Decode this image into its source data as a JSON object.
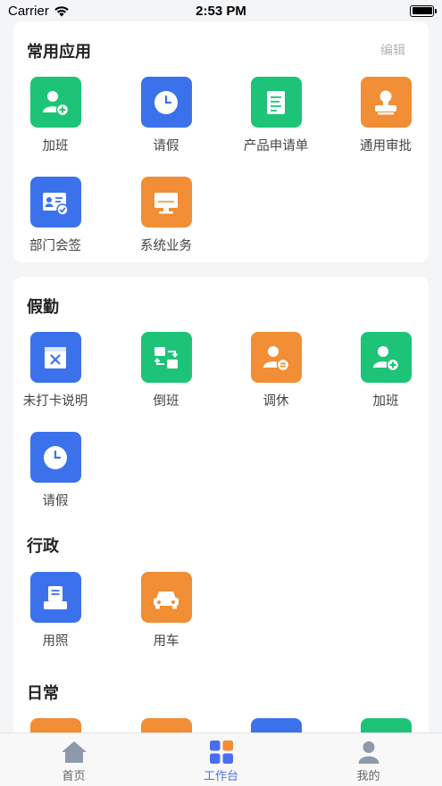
{
  "status_bar": {
    "carrier": "Carrier",
    "time": "2:53 PM"
  },
  "common_apps": {
    "title": "常用应用",
    "edit_label": "编辑",
    "items": [
      {
        "label": "加班",
        "icon": "person-add-icon",
        "color": "#1dc477"
      },
      {
        "label": "请假",
        "icon": "clock-icon",
        "color": "#3b72ec"
      },
      {
        "label": "产品申请单",
        "icon": "document-icon",
        "color": "#1dc477"
      },
      {
        "label": "通用审批",
        "icon": "stamp-icon",
        "color": "#f18e36"
      },
      {
        "label": "部门会签",
        "icon": "id-card-check-icon",
        "color": "#3b72ec"
      },
      {
        "label": "系统业务",
        "icon": "monitor-icon",
        "color": "#f18e36"
      }
    ]
  },
  "sections": [
    {
      "title": "假勤",
      "items": [
        {
          "label": "未打卡说明",
          "icon": "calendar-x-icon",
          "color": "#3b72ec"
        },
        {
          "label": "倒班",
          "icon": "swap-icon",
          "color": "#1dc477"
        },
        {
          "label": "调休",
          "icon": "person-equal-icon",
          "color": "#f18e36"
        },
        {
          "label": "加班",
          "icon": "person-add-icon",
          "color": "#1dc477"
        },
        {
          "label": "请假",
          "icon": "clock-icon",
          "color": "#3b72ec"
        }
      ]
    },
    {
      "title": "行政",
      "items": [
        {
          "label": "用照",
          "icon": "printer-doc-icon",
          "color": "#3b72ec"
        },
        {
          "label": "用车",
          "icon": "car-icon",
          "color": "#f18e36"
        }
      ]
    },
    {
      "title": "日常",
      "items": [
        {
          "label": "",
          "icon": "doc-icon",
          "color": "#f18e36"
        },
        {
          "label": "",
          "icon": "doc-icon",
          "color": "#f18e36"
        },
        {
          "label": "",
          "icon": "doc-icon",
          "color": "#3b72ec"
        },
        {
          "label": "",
          "icon": "doc-icon",
          "color": "#1dc477"
        }
      ]
    }
  ],
  "tab_bar": {
    "items": [
      {
        "label": "首页",
        "icon": "home-icon",
        "active": false
      },
      {
        "label": "工作台",
        "icon": "grid-icon",
        "active": true
      },
      {
        "label": "我的",
        "icon": "user-icon",
        "active": false
      }
    ],
    "active_color": "#4a6ef0"
  }
}
